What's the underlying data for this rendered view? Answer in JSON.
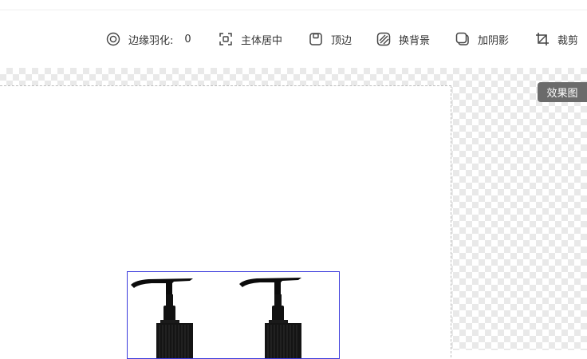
{
  "toolbar": {
    "feather_label": "边缘羽化:",
    "feather_value": "0",
    "center_label": "主体居中",
    "top_edge_label": "顶边",
    "bg_label": "换背景",
    "shadow_label": "加阴影",
    "crop_label": "裁剪"
  },
  "icons": {
    "feather": "target-circle-icon",
    "center": "focus-frame-icon",
    "top_edge": "top-edge-icon",
    "bg": "hatched-circle-icon",
    "shadow": "shadow-square-icon",
    "crop": "crop-icon"
  },
  "canvas": {
    "badge_label": "效果图"
  },
  "colors": {
    "selection": "#3b3bdc",
    "badge_bg": "#6b6b6b",
    "checker": "#e9e9e9",
    "text": "#333333"
  }
}
